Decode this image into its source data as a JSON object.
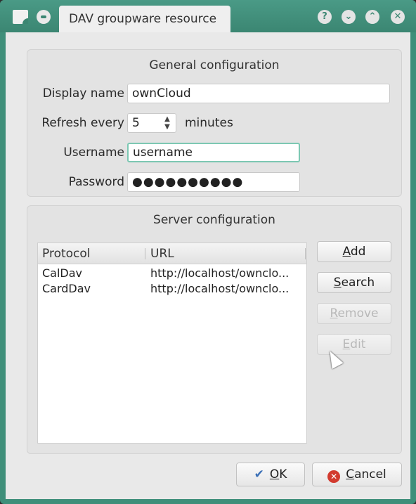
{
  "window": {
    "title": "DAV groupware resource",
    "buttons": {
      "help": "?",
      "minimize": "⌄",
      "maximize": "⌃",
      "close": "✕"
    }
  },
  "general": {
    "title": "General configuration",
    "display_name_label": "Display name",
    "display_name_value": "ownCloud",
    "refresh_label": "Refresh every",
    "refresh_value": "5",
    "refresh_unit": "minutes",
    "username_label": "Username",
    "username_value": "username",
    "password_label": "Password",
    "password_value": "●●●●●●●●●●"
  },
  "server": {
    "title": "Server configuration",
    "columns": {
      "protocol": "Protocol",
      "url": "URL"
    },
    "rows": [
      {
        "protocol": "CalDav",
        "url": "http://localhost/ownclo..."
      },
      {
        "protocol": "CardDav",
        "url": "http://localhost/ownclo..."
      }
    ],
    "buttons": {
      "add": {
        "accel": "A",
        "rest": "dd"
      },
      "search": {
        "accel": "S",
        "rest": "earch"
      },
      "remove": {
        "accel": "R",
        "rest": "emove"
      },
      "edit": {
        "accel": "E",
        "rest": "dit"
      }
    }
  },
  "footer": {
    "ok": {
      "accel": "O",
      "rest": "K"
    },
    "cancel": {
      "accel": "C",
      "rest": "ancel"
    }
  }
}
